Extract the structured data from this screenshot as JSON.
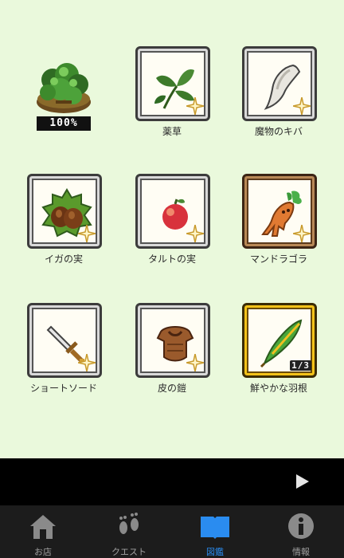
{
  "collection": {
    "featured": {
      "name": "forest-bush-monster",
      "progress_text": "100%"
    },
    "items": [
      {
        "label": "薬草",
        "frame": "silver",
        "icon": "herb-icon",
        "status": "sparkle"
      },
      {
        "label": "魔物のキバ",
        "frame": "silver",
        "icon": "fang-icon",
        "status": "sparkle"
      },
      {
        "label": "イガの実",
        "frame": "silver",
        "icon": "chestnut-icon",
        "status": "sparkle"
      },
      {
        "label": "タルトの実",
        "frame": "silver",
        "icon": "red-fruit-icon",
        "status": "sparkle"
      },
      {
        "label": "マンドラゴラ",
        "frame": "bronze",
        "icon": "mandrake-icon",
        "status": "sparkle"
      },
      {
        "label": "ショートソード",
        "frame": "silver",
        "icon": "short-sword-icon",
        "status": "sparkle"
      },
      {
        "label": "皮の鎧",
        "frame": "silver",
        "icon": "leather-armor-icon",
        "status": "sparkle"
      },
      {
        "label": "鮮やかな羽根",
        "frame": "gold",
        "icon": "feather-icon",
        "status": "count",
        "count_text": "1/3"
      }
    ]
  },
  "play_button": {
    "icon": "play-triangle-icon"
  },
  "tabs": [
    {
      "label": "お店",
      "icon": "house-icon",
      "active": false
    },
    {
      "label": "クエスト",
      "icon": "footprints-icon",
      "active": false
    },
    {
      "label": "図鑑",
      "icon": "open-book-icon",
      "active": true
    },
    {
      "label": "情報",
      "icon": "info-icon",
      "active": false
    }
  ],
  "colors": {
    "background": "#eaf9dc",
    "active_tab": "#2a8cf0",
    "inactive_tab": "#a0a0a0",
    "gold_frame": "#f3c21a"
  }
}
